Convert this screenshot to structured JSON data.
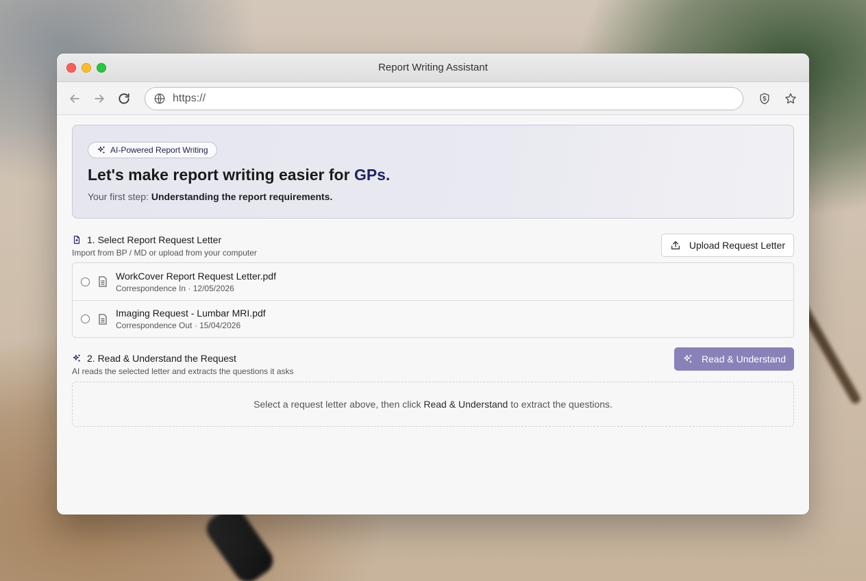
{
  "window": {
    "title": "Report Writing Assistant"
  },
  "toolbar": {
    "url_value": "https://",
    "icons": [
      "back-arrow-icon",
      "forward-arrow-icon",
      "reload-icon",
      "globe-icon",
      "shield-icon",
      "star-icon"
    ]
  },
  "hero": {
    "badge": "AI-Powered Report Writing",
    "title_main": "Let's make report writing easier for ",
    "title_accent": "GPs.",
    "subtitle_prefix": "Your first step: ",
    "subtitle_bold": "Understanding the report requirements."
  },
  "section1": {
    "title": "1. Select Report Request Letter",
    "description": "Import from BP / MD or upload from your computer",
    "upload_label": "Upload Request Letter",
    "files": [
      {
        "name": "WorkCover Report Request Letter.pdf",
        "meta": "Correspondence In · 12/05/2026"
      },
      {
        "name": "Imaging Request - Lumbar MRI.pdf",
        "meta": "Correspondence Out · 15/04/2026"
      }
    ]
  },
  "section2": {
    "title": "2. Read & Understand the Request",
    "description": "AI reads the selected letter and extracts the questions it asks",
    "button_label": "Read & Understand",
    "empty_prefix": "Select a request letter above, then click ",
    "empty_bold": "Read & Understand",
    "empty_suffix": " to extract the questions."
  },
  "colors": {
    "accent": "#1f2466",
    "primary_button": "#8882b8",
    "traffic_red": "#fe5f57",
    "traffic_yellow": "#febc2e",
    "traffic_green": "#28c840"
  }
}
